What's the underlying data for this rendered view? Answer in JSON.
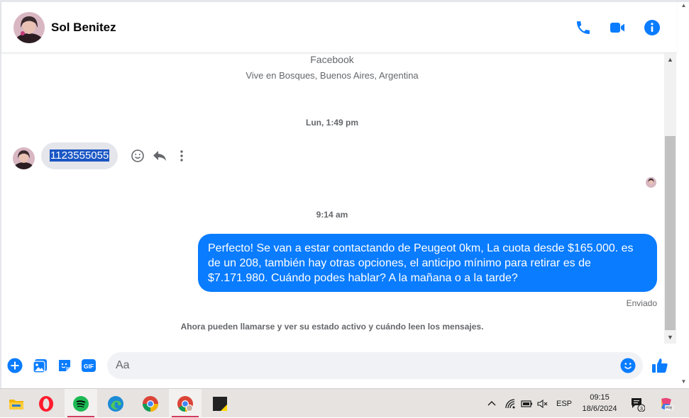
{
  "header": {
    "contact_name": "Sol Benitez",
    "icons": [
      "phone-icon",
      "video-camera-icon",
      "info-icon"
    ]
  },
  "profile": {
    "source_label": "Facebook",
    "location": "Vive en Bosques, Buenos Aires, Argentina"
  },
  "conversation": {
    "timestamp_1": "Lun, 1:49 pm",
    "incoming_message": "1123555055",
    "timestamp_2": "9:14 am",
    "outgoing_message": "Perfecto!  Se van a estar contactando de Peugeot 0km, La cuota desde $165.000. es de un 208, también hay otras opciones, el anticipo mínimo para retirar es de $7.171.980. Cuándo podes hablar? A la mañana o a la tarde?",
    "status": "Enviado",
    "notice": "Ahora pueden llamarse y ver su estado activo y cuándo leen los mensajes."
  },
  "composer": {
    "placeholder": "Aa"
  },
  "colors": {
    "accent": "#0a7cff",
    "incoming_bubble": "#e4e6eb",
    "header_icons": "#0a7cff"
  },
  "taskbar": {
    "apps": [
      "file-explorer",
      "opera",
      "spotify",
      "edge",
      "chrome",
      "chrome-profile",
      "sticky-notes"
    ],
    "language": "ESP",
    "time": "09:15",
    "date": "18/6/2024",
    "notification_count": "3"
  }
}
